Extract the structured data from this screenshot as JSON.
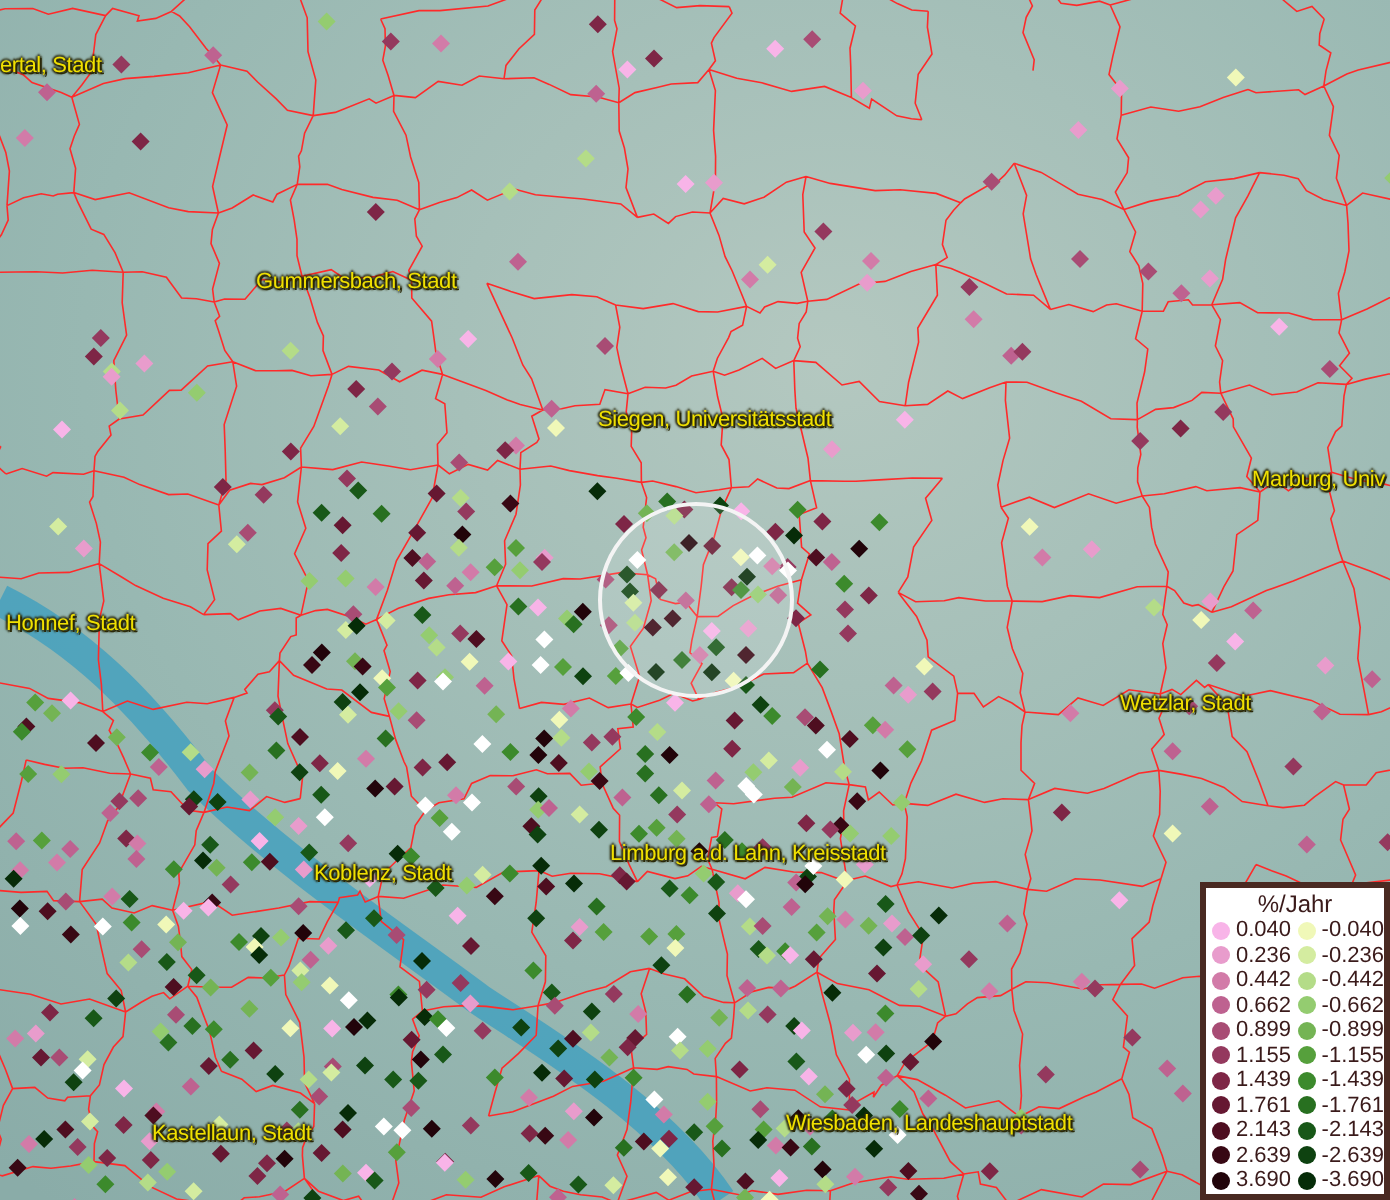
{
  "map": {
    "places": [
      {
        "kind": "town",
        "name": "ertal, Stadt"
      },
      {
        "kind": "town",
        "name": "Gummersbach, Stadt"
      },
      {
        "kind": "town",
        "name": "Siegen, Universitätsstadt"
      },
      {
        "kind": "town",
        "name": "Marburg, Univ"
      },
      {
        "kind": "town",
        "name": "Honnef, Stadt"
      },
      {
        "kind": "town",
        "name": "Wetzlar, Stadt"
      },
      {
        "kind": "town",
        "name": "Limburg a.d. Lahn, Kreisstadt"
      },
      {
        "kind": "town",
        "name": "Koblenz, Stadt"
      },
      {
        "kind": "town",
        "name": "Kastellaun, Stadt"
      },
      {
        "kind": "town",
        "name": "Wiesbaden, Landeshauptstadt"
      }
    ]
  },
  "legend": {
    "title": "%/Jahr",
    "rows": [
      {
        "left": {
          "label": "0.040",
          "color": "#f8b4e8"
        },
        "right": {
          "label": "-0.040",
          "color": "#f0f8b8"
        }
      },
      {
        "left": {
          "label": "0.236",
          "color": "#e89ccc"
        },
        "right": {
          "label": "-0.236",
          "color": "#d4eca0"
        }
      },
      {
        "left": {
          "label": "0.442",
          "color": "#d27ba8"
        },
        "right": {
          "label": "-0.442",
          "color": "#b4dc88"
        }
      },
      {
        "left": {
          "label": "0.662",
          "color": "#be6290"
        },
        "right": {
          "label": "-0.662",
          "color": "#94cc70"
        }
      },
      {
        "left": {
          "label": "0.899",
          "color": "#a84c74"
        },
        "right": {
          "label": "-0.899",
          "color": "#74b454"
        }
      },
      {
        "left": {
          "label": "1.155",
          "color": "#94395e"
        },
        "right": {
          "label": "-1.155",
          "color": "#56a03c"
        }
      },
      {
        "left": {
          "label": "1.439",
          "color": "#7e2646"
        },
        "right": {
          "label": "-1.439",
          "color": "#3c8a2c"
        }
      },
      {
        "left": {
          "label": "1.761",
          "color": "#661832"
        },
        "right": {
          "label": "-1.761",
          "color": "#287020"
        }
      },
      {
        "left": {
          "label": "2.143",
          "color": "#4e0e20"
        },
        "right": {
          "label": "-2.143",
          "color": "#185818"
        }
      },
      {
        "left": {
          "label": "2.639",
          "color": "#380814"
        },
        "right": {
          "label": "-2.639",
          "color": "#0e4210"
        }
      },
      {
        "left": {
          "label": "3.690",
          "color": "#22040a"
        },
        "right": {
          "label": "-3.690",
          "color": "#062c08"
        }
      }
    ]
  }
}
